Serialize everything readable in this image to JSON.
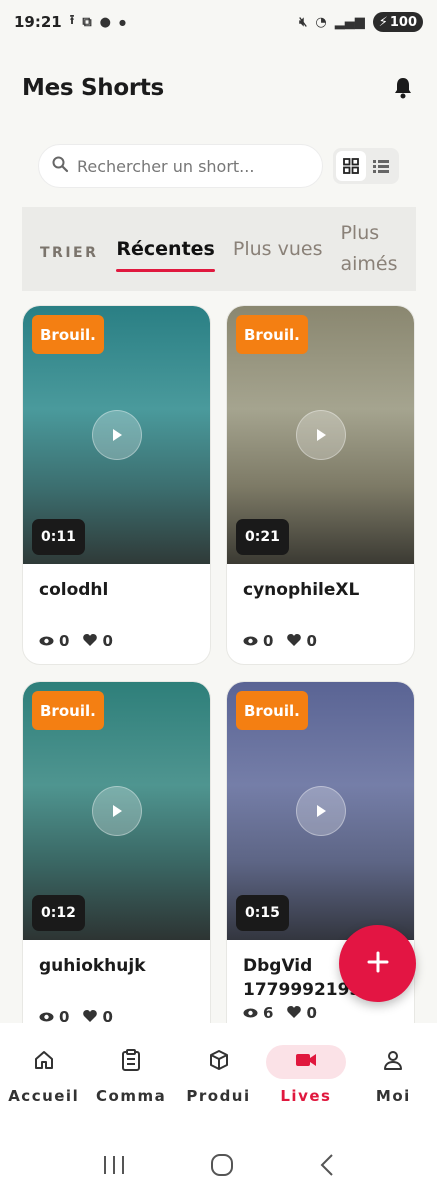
{
  "status_bar": {
    "time": "19:21",
    "battery": "100"
  },
  "header": {
    "title": "Mes Shorts"
  },
  "search": {
    "placeholder": "Rechercher un short..."
  },
  "sort": {
    "label": "TRIER",
    "tabs": [
      "Récentes",
      "Plus vues",
      "Plus\naimés"
    ],
    "active": "Récentes"
  },
  "colors": {
    "accent": "#e31543",
    "draft_badge": "#f47f12"
  },
  "cards": [
    {
      "badge": "Brouil.",
      "duration": "0:11",
      "title": "colodhl",
      "views": "0",
      "likes": "0"
    },
    {
      "badge": "Brouil.",
      "duration": "0:21",
      "title": "cynophileXL",
      "views": "0",
      "likes": "0"
    },
    {
      "badge": "Brouil.",
      "duration": "0:12",
      "title": "guhiokhujk",
      "views": "0",
      "likes": "0"
    },
    {
      "badge": "Brouil.",
      "duration": "0:15",
      "title": "DbgVid 1779992193",
      "views": "6",
      "likes": "0"
    }
  ],
  "bottom_nav": {
    "items": [
      "Accueil",
      "Comma",
      "Produi",
      "Lives",
      "Moi"
    ],
    "active": "Lives"
  }
}
